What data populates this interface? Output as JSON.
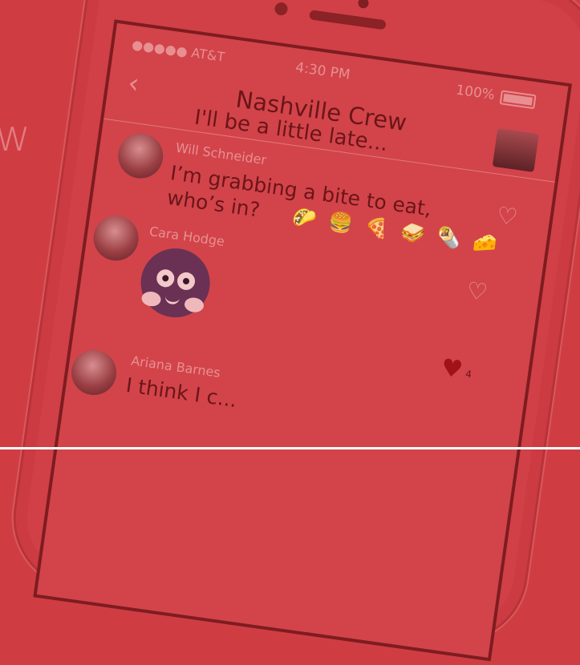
{
  "background": {
    "partial_heading": "w",
    "accent_color": "#cf3d42"
  },
  "phone": {
    "status_bar": {
      "carrier": "●●●●● AT&T",
      "time": "4:30 PM",
      "battery": "100%"
    },
    "chat": {
      "back_icon": "chevron-left-icon",
      "title": "Nashville Crew",
      "top_message": "I'll be a little late...",
      "messages": [
        {
          "sender": "Will Schneider",
          "text": "I’m grabbing a bite to eat, who’s in?",
          "emojis": "🌮 🍔 🍕 🥪 🌯 🧀"
        },
        {
          "sender": "Cara Hodge",
          "sticker": "purple-monster-sticker"
        },
        {
          "sender": "Ariana Barnes",
          "text": "I think I c..."
        }
      ],
      "likes": {
        "count": "4"
      }
    }
  }
}
